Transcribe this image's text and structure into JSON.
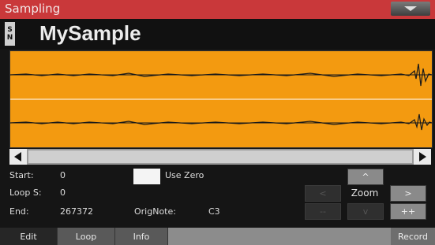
{
  "window": {
    "title": "Sampling"
  },
  "header": {
    "badge_top": "S",
    "badge_bottom": "N",
    "sample_name": "MySample"
  },
  "params": {
    "start_label": "Start:",
    "start_value": "0",
    "loop_label": "Loop S:",
    "loop_value": "0",
    "end_label": "End:",
    "end_value": "267372",
    "orignote_label": "OrigNote:",
    "orignote_value": "C3",
    "usezero_label": "Use Zero"
  },
  "zoom": {
    "label": "Zoom",
    "up": "^",
    "left": "<",
    "right": ">",
    "minus": "--",
    "down": "v",
    "plus": "++"
  },
  "tabs": [
    "Edit",
    "Loop",
    "Info"
  ],
  "record_label": "Record",
  "colors": {
    "titlebar": "#c9383a",
    "waveform_bg": "#f39a10",
    "waveform": "#1a1a1a"
  }
}
